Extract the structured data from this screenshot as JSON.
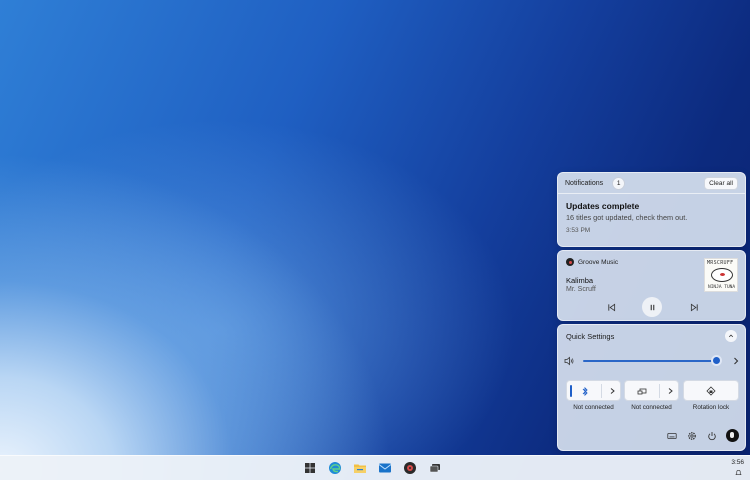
{
  "notifications": {
    "title": "Notifications",
    "count": "1",
    "clear_label": "Clear all",
    "items": [
      {
        "heading": "Updates complete",
        "body": "16 titles got updated, check them out.",
        "time": "3:53 PM"
      }
    ]
  },
  "media": {
    "app_name": "Groove Music",
    "song": "Kalimba",
    "artist": "Mr. Scruff",
    "album_art_text_top": "MRSCRUFF",
    "album_art_text_bottom": "NINJA TUNA",
    "controls": [
      "previous-track",
      "pause",
      "next-track"
    ]
  },
  "quick_settings": {
    "title": "Quick Settings",
    "volume_level": 0.96,
    "tiles": [
      {
        "icon": "bluetooth-icon",
        "label": "Not connected"
      },
      {
        "icon": "project-icon",
        "label": "Not connected"
      },
      {
        "icon": "rotation-lock-icon",
        "label": "Rotation lock"
      }
    ],
    "footer_icons": [
      "keyboard-icon",
      "settings-icon",
      "power-icon",
      "user-avatar"
    ]
  },
  "taskbar": {
    "apps": [
      "start-icon",
      "edge-icon",
      "file-explorer-icon",
      "mail-icon",
      "groove-music-icon",
      "task-view-icon"
    ],
    "clock": "3:56"
  },
  "colors": {
    "accent": "#1f5fc8",
    "panel_bg": "#d6e0ee",
    "taskbar_bg": "#ecf1f8"
  }
}
